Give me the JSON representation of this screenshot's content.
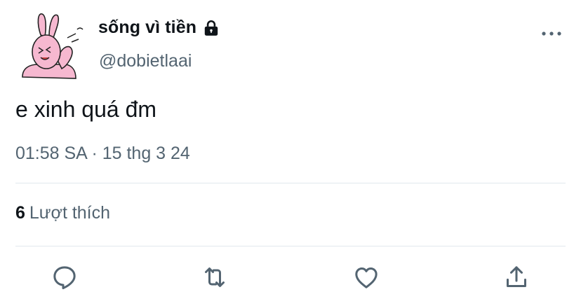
{
  "user": {
    "display_name": "sống vì tiền",
    "handle": "@dobietlaai",
    "protected_icon": "lock-icon",
    "avatar_desc_icon": "pink-bunny-avatar"
  },
  "tweet": {
    "text": "e xinh quá đm",
    "time": "01:58 SA",
    "separator": "·",
    "date": "15 thg 3 24"
  },
  "stats": {
    "likes_count": "6",
    "likes_label": "Lượt thích"
  },
  "actions": {
    "more_icon": "more-icon",
    "reply_icon": "reply-icon",
    "retweet_icon": "retweet-icon",
    "like_icon": "heart-icon",
    "share_icon": "share-icon"
  },
  "colors": {
    "text_primary": "#0f1419",
    "text_secondary": "#536471",
    "icon": "#536471",
    "divider": "#e1e8ed",
    "avatar_pink": "#f6b8d0"
  }
}
